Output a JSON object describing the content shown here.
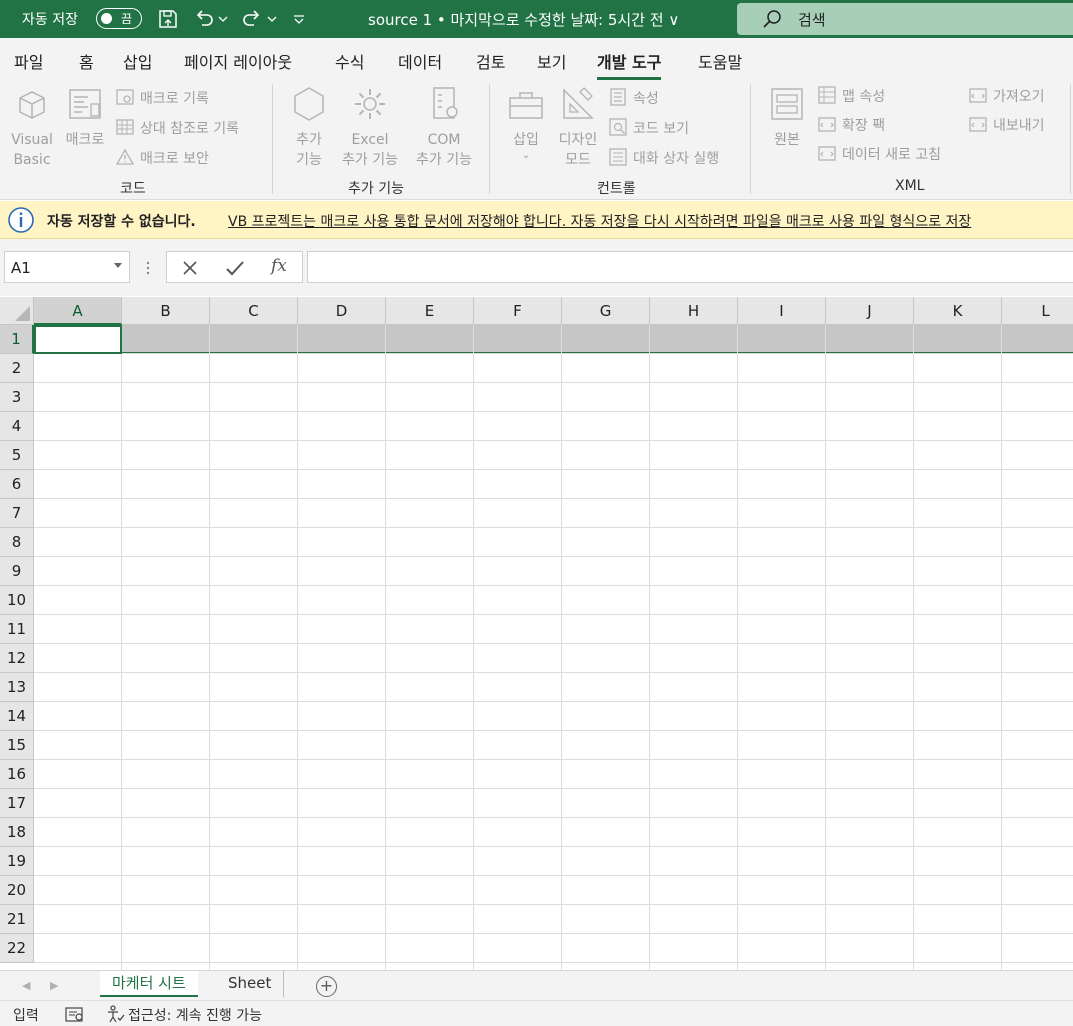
{
  "titlebar": {
    "autosave_label": "자동 저장",
    "autosave_state": "끔",
    "title": "source 1 • 마지막으로 수정한 날짜: 5시간 전 ∨",
    "search_placeholder": "검색",
    "accent_color": "#217346"
  },
  "tabs": [
    {
      "label": "파일"
    },
    {
      "label": "홈"
    },
    {
      "label": "삽입"
    },
    {
      "label": "페이지 레이아웃"
    },
    {
      "label": "수식"
    },
    {
      "label": "데이터"
    },
    {
      "label": "검토"
    },
    {
      "label": "보기"
    },
    {
      "label": "개발 도구",
      "active": true
    },
    {
      "label": "도움말"
    }
  ],
  "ribbon": {
    "code": {
      "label": "코드",
      "visual_basic_1": "Visual",
      "visual_basic_2": "Basic",
      "macro": "매크로",
      "record_macro": "매크로 기록",
      "relative_ref": "상대 참조로 기록",
      "macro_security": "매크로 보안"
    },
    "addins": {
      "label": "추가 기능",
      "addins_1": "추가",
      "addins_2": "기능",
      "excel_1": "Excel",
      "excel_2": "추가 기능",
      "com_1": "COM",
      "com_2": "추가 기능"
    },
    "controls": {
      "label": "컨트롤",
      "insert": "삽입",
      "design_1": "디자인",
      "design_2": "모드",
      "properties": "속성",
      "view_code": "코드 보기",
      "run_dialog": "대화 상자 실행"
    },
    "xml": {
      "label": "XML",
      "source": "원본",
      "map_properties": "맵 속성",
      "expansion_packs": "확장 팩",
      "refresh_data": "데이터 새로 고침",
      "import": "가져오기",
      "export": "내보내기"
    }
  },
  "message_bar": {
    "title": "자동 저장할 수 없습니다.",
    "text": "VB 프로젝트는 매크로 사용 통합 문서에 저장해야 합니다. 자동 저장을 다시 시작하려면 파일을 매크로 사용 파일 형식으로 저장"
  },
  "formula_bar": {
    "name_box": "A1",
    "fx": "fx",
    "formula": ""
  },
  "grid": {
    "columns": [
      "A",
      "B",
      "C",
      "D",
      "E",
      "F",
      "G",
      "H",
      "I",
      "J",
      "K",
      "L"
    ],
    "rows": [
      "1",
      "2",
      "3",
      "4",
      "5",
      "6",
      "7",
      "8",
      "9",
      "10",
      "11",
      "12",
      "13",
      "14",
      "15",
      "16",
      "17",
      "18",
      "19",
      "20",
      "21",
      "22"
    ],
    "active_cell": "A1"
  },
  "sheets": {
    "active": "마케터 시트",
    "other": "Sheet"
  },
  "status": {
    "mode": "입력",
    "accessibility": "접근성: 계속 진행 가능"
  }
}
